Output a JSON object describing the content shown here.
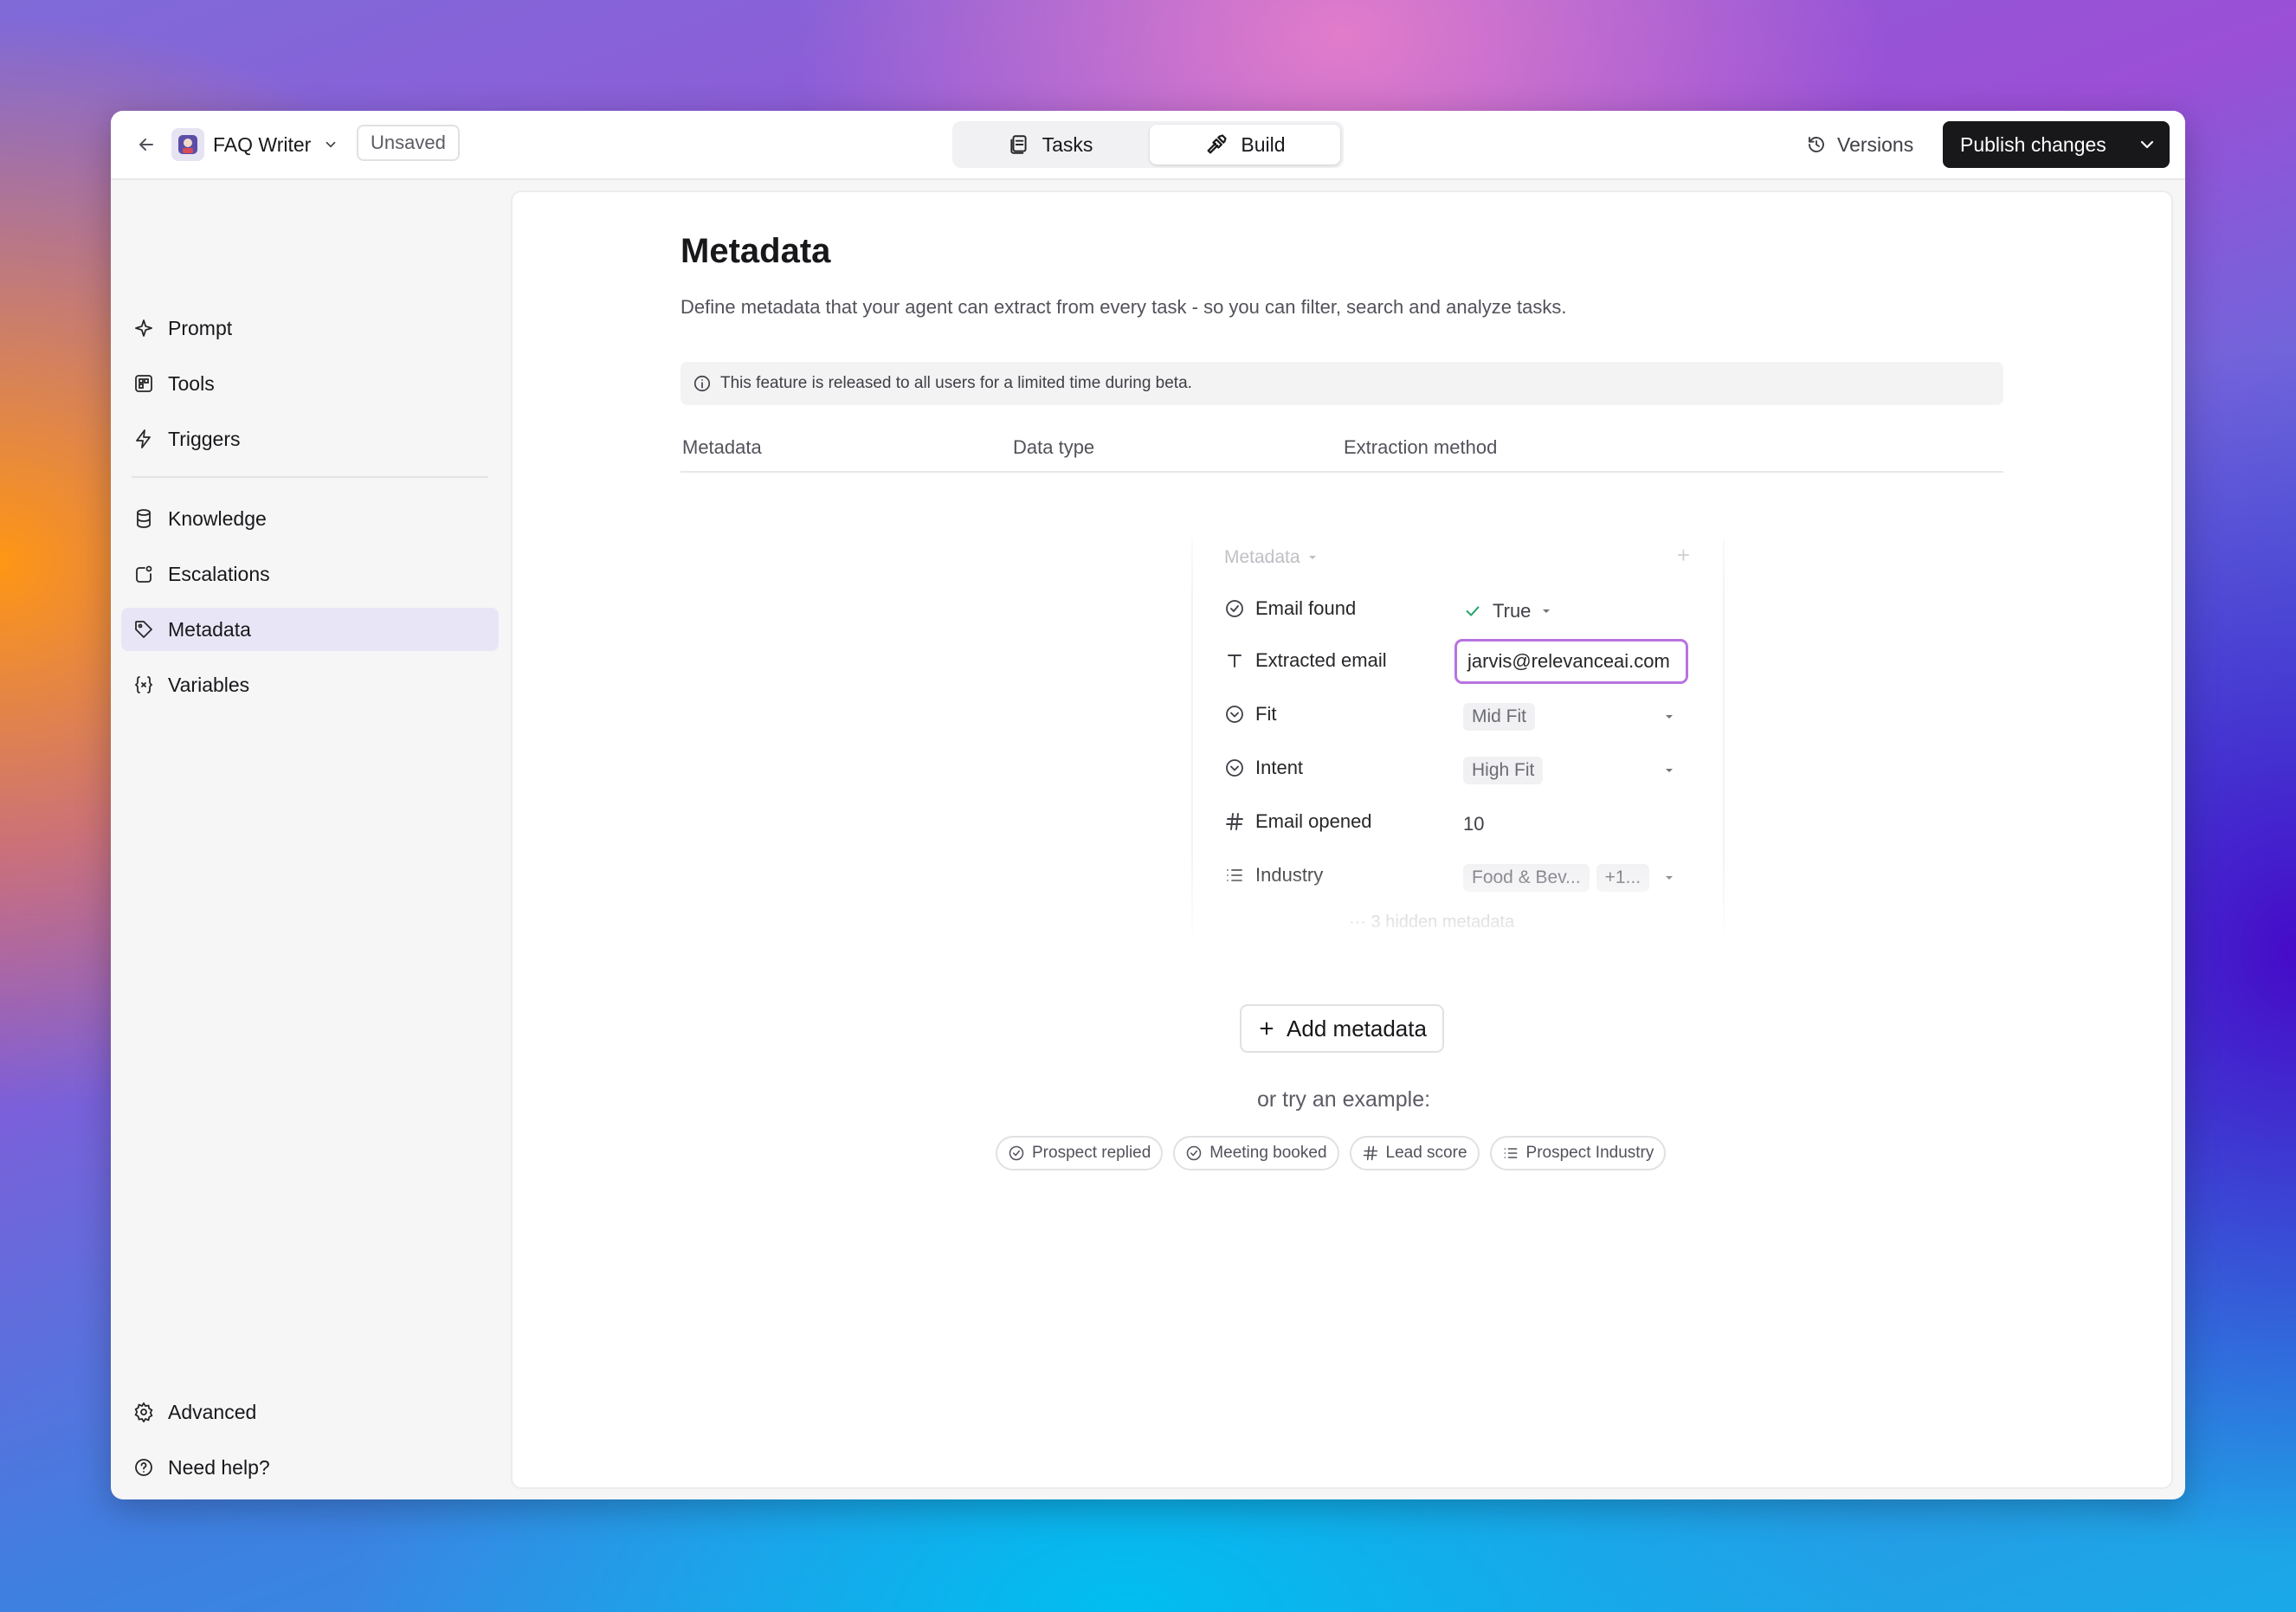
{
  "topbar": {
    "agent_name": "FAQ Writer",
    "save_status": "Unsaved",
    "tabs": [
      {
        "label": "Tasks"
      },
      {
        "label": "Build"
      }
    ],
    "versions_label": "Versions",
    "publish_label": "Publish changes"
  },
  "sidebar": {
    "items": [
      {
        "label": "Prompt",
        "icon": "sparkle-icon"
      },
      {
        "label": "Tools",
        "icon": "tools-icon"
      },
      {
        "label": "Triggers",
        "icon": "bolt-icon"
      },
      {
        "label": "Knowledge",
        "icon": "database-icon"
      },
      {
        "label": "Escalations",
        "icon": "escalation-icon"
      },
      {
        "label": "Metadata",
        "icon": "tag-icon",
        "active": true
      },
      {
        "label": "Variables",
        "icon": "variable-icon"
      }
    ],
    "footer": [
      {
        "label": "Advanced",
        "icon": "gear-icon"
      },
      {
        "label": "Need help?",
        "icon": "help-icon"
      }
    ]
  },
  "main": {
    "title": "Metadata",
    "subtitle": "Define metadata that your agent can extract from every task - so you can filter, search and analyze tasks.",
    "beta_notice": "This feature is released to all users for a limited time during beta.",
    "columns": [
      "Metadata",
      "Data type",
      "Extraction method"
    ],
    "preview": {
      "header": "Metadata",
      "rows": [
        {
          "label": "Email found",
          "value": "True"
        },
        {
          "label": "Extracted email",
          "value": "jarvis@relevanceai.com"
        },
        {
          "label": "Fit",
          "value": "Mid Fit"
        },
        {
          "label": "Intent",
          "value": "High Fit"
        },
        {
          "label": "Email opened",
          "value": "10"
        },
        {
          "label": "Industry",
          "value": "Food & Bev...",
          "extra": "+1..."
        }
      ],
      "hidden_note": "··· 3 hidden metadata"
    },
    "add_button": "Add metadata",
    "try_example": "or try an example:",
    "examples": [
      "Prospect replied",
      "Meeting booked",
      "Lead score",
      "Prospect Industry"
    ]
  },
  "colors": {
    "accent_active_bg": "#e8e6f6",
    "focus_border": "#b873e0",
    "primary_button": "#18181b",
    "check_green": "#22a66a"
  }
}
